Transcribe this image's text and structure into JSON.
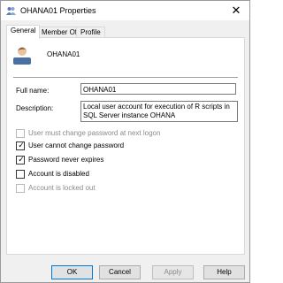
{
  "window": {
    "title": "OHANA01 Properties",
    "close_glyph": "✕"
  },
  "tabs": [
    {
      "label": "General",
      "active": true
    },
    {
      "label": "Member Of",
      "active": false
    },
    {
      "label": "Profile",
      "active": false
    }
  ],
  "general": {
    "user_name": "OHANA01",
    "full_name_label": "Full name:",
    "full_name_value": "OHANA01",
    "description_label": "Description:",
    "description_value": "Local user account for execution of R scripts in SQL Server instance OHANA"
  },
  "checkboxes": [
    {
      "label": "User must change password at next logon",
      "checked": false,
      "enabled": false
    },
    {
      "label": "User cannot change password",
      "checked": true,
      "enabled": true
    },
    {
      "label": "Password never expires",
      "checked": true,
      "enabled": true
    },
    {
      "label": "Account is disabled",
      "checked": false,
      "enabled": true
    },
    {
      "label": "Account is locked out",
      "checked": false,
      "enabled": false
    }
  ],
  "buttons": {
    "ok": "OK",
    "cancel": "Cancel",
    "apply": "Apply",
    "help": "Help"
  },
  "icons": {
    "title_icon": "users-icon",
    "user_icon": "user-icon"
  },
  "colors": {
    "default_button_border": "#0078d7",
    "disabled_text": "#8a8a8a"
  }
}
